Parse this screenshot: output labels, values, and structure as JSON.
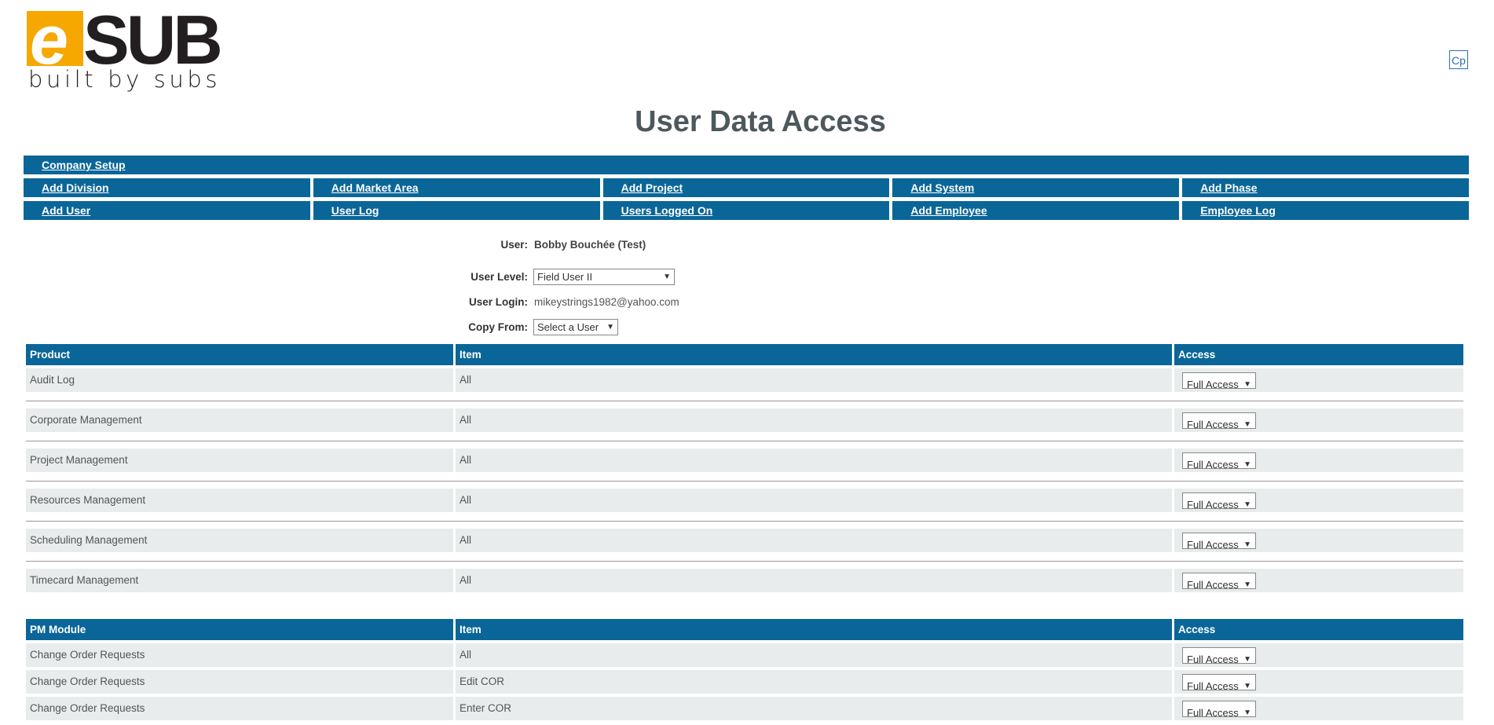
{
  "logo": {
    "letter": "e",
    "brand": "SUB",
    "tagline": "built by subs"
  },
  "cp_button": "Cp",
  "title": "User Data Access",
  "nav": {
    "company_setup": "Company Setup",
    "row1": [
      "Add Division",
      "Add Market Area",
      "Add Project",
      "Add System",
      "Add Phase"
    ],
    "row2": [
      "Add User",
      "User Log",
      "Users Logged On",
      "Add Employee",
      "Employee Log"
    ]
  },
  "user_info": {
    "user_label": "User:",
    "user_value": "Bobby Bouchée (Test)",
    "level_label": "User Level:",
    "level_value": "Field User II",
    "login_label": "User Login:",
    "login_value": "mikeystrings1982@yahoo.com",
    "copy_label": "Copy From:",
    "copy_value": "Select a User"
  },
  "product_table": {
    "headers": [
      "Product",
      "Item",
      "Access"
    ],
    "rows": [
      {
        "product": "Audit Log",
        "item": "All",
        "access": "Full Access"
      },
      {
        "product": "Corporate Management",
        "item": "All",
        "access": "Full Access"
      },
      {
        "product": "Project Management",
        "item": "All",
        "access": "Full Access"
      },
      {
        "product": "Resources Management",
        "item": "All",
        "access": "Full Access"
      },
      {
        "product": "Scheduling Management",
        "item": "All",
        "access": "Full Access"
      },
      {
        "product": "Timecard Management",
        "item": "All",
        "access": "Full Access"
      }
    ]
  },
  "pm_table": {
    "headers": [
      "PM Module",
      "Item",
      "Access"
    ],
    "rows": [
      {
        "product": "Change Order Requests",
        "item": "All",
        "access": "Full Access"
      },
      {
        "product": "Change Order Requests",
        "item": "Edit COR",
        "access": "Full Access"
      },
      {
        "product": "Change Order Requests",
        "item": "Enter COR",
        "access": "Full Access"
      }
    ]
  },
  "colors": {
    "nav_blue": "#0a6698",
    "row_bg": "#e8ecec",
    "logo_orange": "#f6a800"
  }
}
